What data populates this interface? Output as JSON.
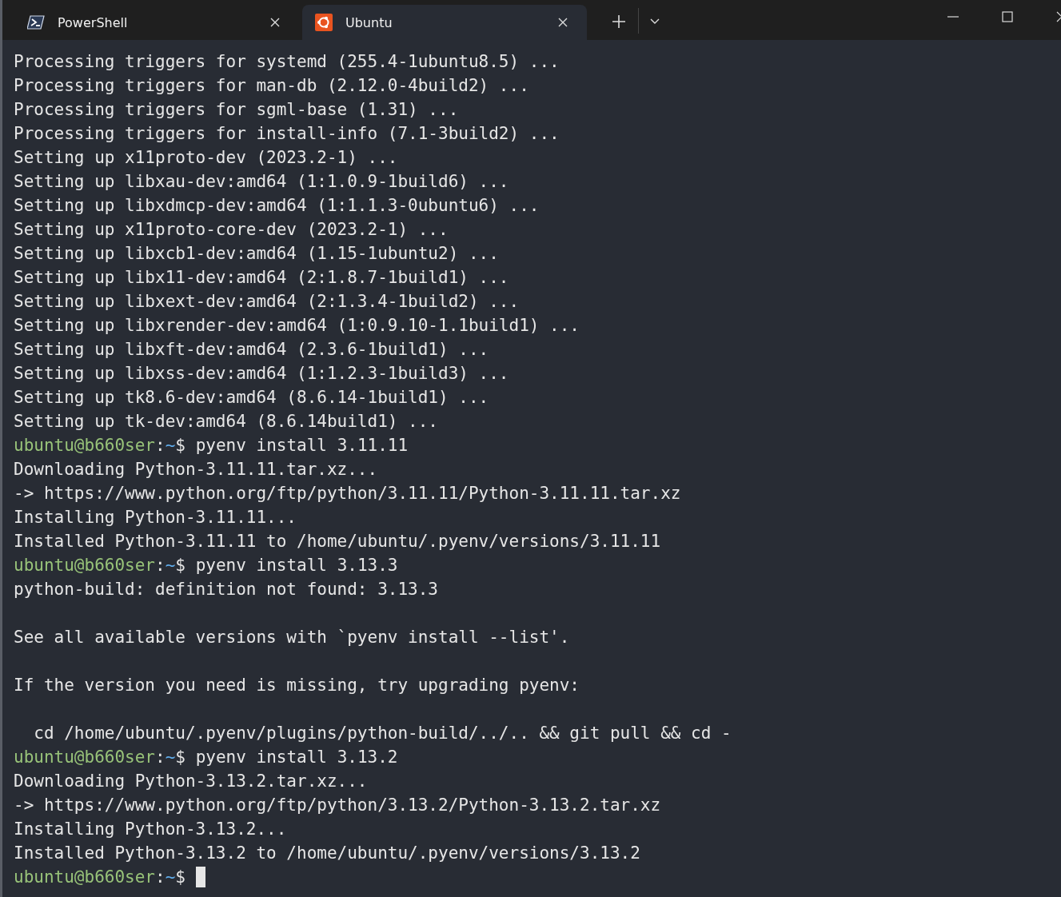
{
  "tabs": [
    {
      "title": "PowerShell",
      "selected": false
    },
    {
      "title": "Ubuntu",
      "selected": true
    }
  ],
  "lines": [
    {
      "kind": "output",
      "text": "Processing triggers for systemd (255.4-1ubuntu8.5) ..."
    },
    {
      "kind": "output",
      "text": "Processing triggers for man-db (2.12.0-4build2) ..."
    },
    {
      "kind": "output",
      "text": "Processing triggers for sgml-base (1.31) ..."
    },
    {
      "kind": "output",
      "text": "Processing triggers for install-info (7.1-3build2) ..."
    },
    {
      "kind": "output",
      "text": "Setting up x11proto-dev (2023.2-1) ..."
    },
    {
      "kind": "output",
      "text": "Setting up libxau-dev:amd64 (1:1.0.9-1build6) ..."
    },
    {
      "kind": "output",
      "text": "Setting up libxdmcp-dev:amd64 (1:1.1.3-0ubuntu6) ..."
    },
    {
      "kind": "output",
      "text": "Setting up x11proto-core-dev (2023.2-1) ..."
    },
    {
      "kind": "output",
      "text": "Setting up libxcb1-dev:amd64 (1.15-1ubuntu2) ..."
    },
    {
      "kind": "output",
      "text": "Setting up libx11-dev:amd64 (2:1.8.7-1build1) ..."
    },
    {
      "kind": "output",
      "text": "Setting up libxext-dev:amd64 (2:1.3.4-1build2) ..."
    },
    {
      "kind": "output",
      "text": "Setting up libxrender-dev:amd64 (1:0.9.10-1.1build1) ..."
    },
    {
      "kind": "output",
      "text": "Setting up libxft-dev:amd64 (2.3.6-1build1) ..."
    },
    {
      "kind": "output",
      "text": "Setting up libxss-dev:amd64 (1:1.2.3-1build3) ..."
    },
    {
      "kind": "output",
      "text": "Setting up tk8.6-dev:amd64 (8.6.14-1build1) ..."
    },
    {
      "kind": "output",
      "text": "Setting up tk-dev:amd64 (8.6.14build1) ..."
    },
    {
      "kind": "prompt",
      "user_host": "ubuntu@b660ser",
      "separator": ":",
      "path": "~",
      "symbol": "$",
      "command": "pyenv install 3.11.11",
      "cursor": false
    },
    {
      "kind": "output",
      "text": "Downloading Python-3.11.11.tar.xz..."
    },
    {
      "kind": "output",
      "text": "-> https://www.python.org/ftp/python/3.11.11/Python-3.11.11.tar.xz"
    },
    {
      "kind": "output",
      "text": "Installing Python-3.11.11..."
    },
    {
      "kind": "output",
      "text": "Installed Python-3.11.11 to /home/ubuntu/.pyenv/versions/3.11.11"
    },
    {
      "kind": "prompt",
      "user_host": "ubuntu@b660ser",
      "separator": ":",
      "path": "~",
      "symbol": "$",
      "command": "pyenv install 3.13.3",
      "cursor": false
    },
    {
      "kind": "output",
      "text": "python-build: definition not found: 3.13.3"
    },
    {
      "kind": "blank"
    },
    {
      "kind": "output",
      "text": "See all available versions with `pyenv install --list'."
    },
    {
      "kind": "blank"
    },
    {
      "kind": "output",
      "text": "If the version you need is missing, try upgrading pyenv:"
    },
    {
      "kind": "blank"
    },
    {
      "kind": "output",
      "text": "  cd /home/ubuntu/.pyenv/plugins/python-build/../.. && git pull && cd -"
    },
    {
      "kind": "prompt",
      "user_host": "ubuntu@b660ser",
      "separator": ":",
      "path": "~",
      "symbol": "$",
      "command": "pyenv install 3.13.2",
      "cursor": false
    },
    {
      "kind": "output",
      "text": "Downloading Python-3.13.2.tar.xz..."
    },
    {
      "kind": "output",
      "text": "-> https://www.python.org/ftp/python/3.13.2/Python-3.13.2.tar.xz"
    },
    {
      "kind": "output",
      "text": "Installing Python-3.13.2..."
    },
    {
      "kind": "output",
      "text": "Installed Python-3.13.2 to /home/ubuntu/.pyenv/versions/3.13.2"
    },
    {
      "kind": "prompt",
      "user_host": "ubuntu@b660ser",
      "separator": ":",
      "path": "~",
      "symbol": "$",
      "cursor": true
    }
  ]
}
